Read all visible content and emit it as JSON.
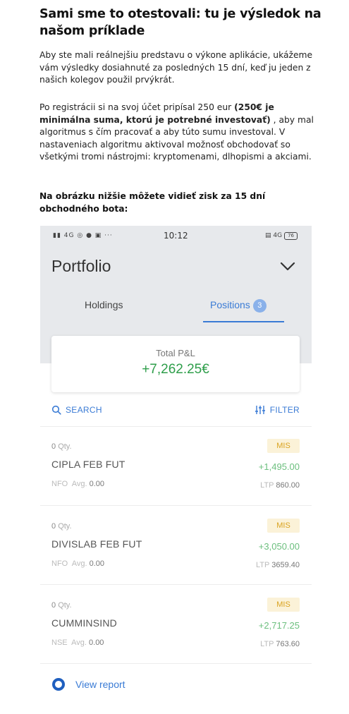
{
  "article": {
    "headline": "Sami sme to otestovali: tu je výsledok na našom príklade",
    "paragraph1": "Aby ste mali reálnejšiu predstavu o výkone aplikácie, ukážeme vám výsledky dosiahnuté za posledných 15 dní, keď ju jeden z našich kolegov použil prvýkrát.",
    "paragraph2_start": "Po registrácii si na svoj účet pripísal 250 eur ",
    "paragraph2_bold": "(250€ je minimálna suma, ktorú je potrebné investovať)",
    "paragraph2_end": " , aby mal algoritmus s čím pracovať a aby túto sumu investoval. V nastaveniach algoritmu aktivoval možnosť obchodovať so všetkými tromi nástrojmi: kryptomenami, dlhopismi a akciami.",
    "paragraph3": "Na obrázku nižšie môžete vidieť zisk za 15 dní obchodného bota:"
  },
  "phone": {
    "status_time": "10:12",
    "status_left": "4G",
    "status_right": "4G",
    "battery": "76",
    "title": "Portfolio",
    "tabs": [
      {
        "label": "Holdings"
      },
      {
        "label": "Positions",
        "badge": "3"
      }
    ],
    "total_pnl_label": "Total P&L",
    "total_pnl_value": "+7,262.25€",
    "search_label": "SEARCH",
    "filter_label": "FILTER",
    "positions": [
      {
        "qty_num": "0",
        "qty_unit": "Qty.",
        "product": "MIS",
        "symbol": "CIPLA FEB FUT",
        "pnl": "+1,495.00",
        "exchange": "NFO",
        "avg_label": "Avg.",
        "avg": "0.00",
        "ltp_label": "LTP",
        "ltp": "860.00"
      },
      {
        "qty_num": "0",
        "qty_unit": "Qty.",
        "product": "MIS",
        "symbol": "DIVISLAB FEB FUT",
        "pnl": "+3,050.00",
        "exchange": "NFO",
        "avg_label": "Avg.",
        "avg": "0.00",
        "ltp_label": "LTP",
        "ltp": "3659.40"
      },
      {
        "qty_num": "0",
        "qty_unit": "Qty.",
        "product": "MIS",
        "symbol": "CUMMINSIND",
        "pnl": "+2,717.25",
        "exchange": "NSE",
        "avg_label": "Avg.",
        "avg": "0.00",
        "ltp_label": "LTP",
        "ltp": "763.60"
      }
    ],
    "view_report_label": "View report"
  },
  "colors": {
    "accent": "#3a7bd5",
    "profit": "#2e9e4a",
    "mis_bg": "#fbf2d8",
    "mis_text": "#d9a21e"
  }
}
